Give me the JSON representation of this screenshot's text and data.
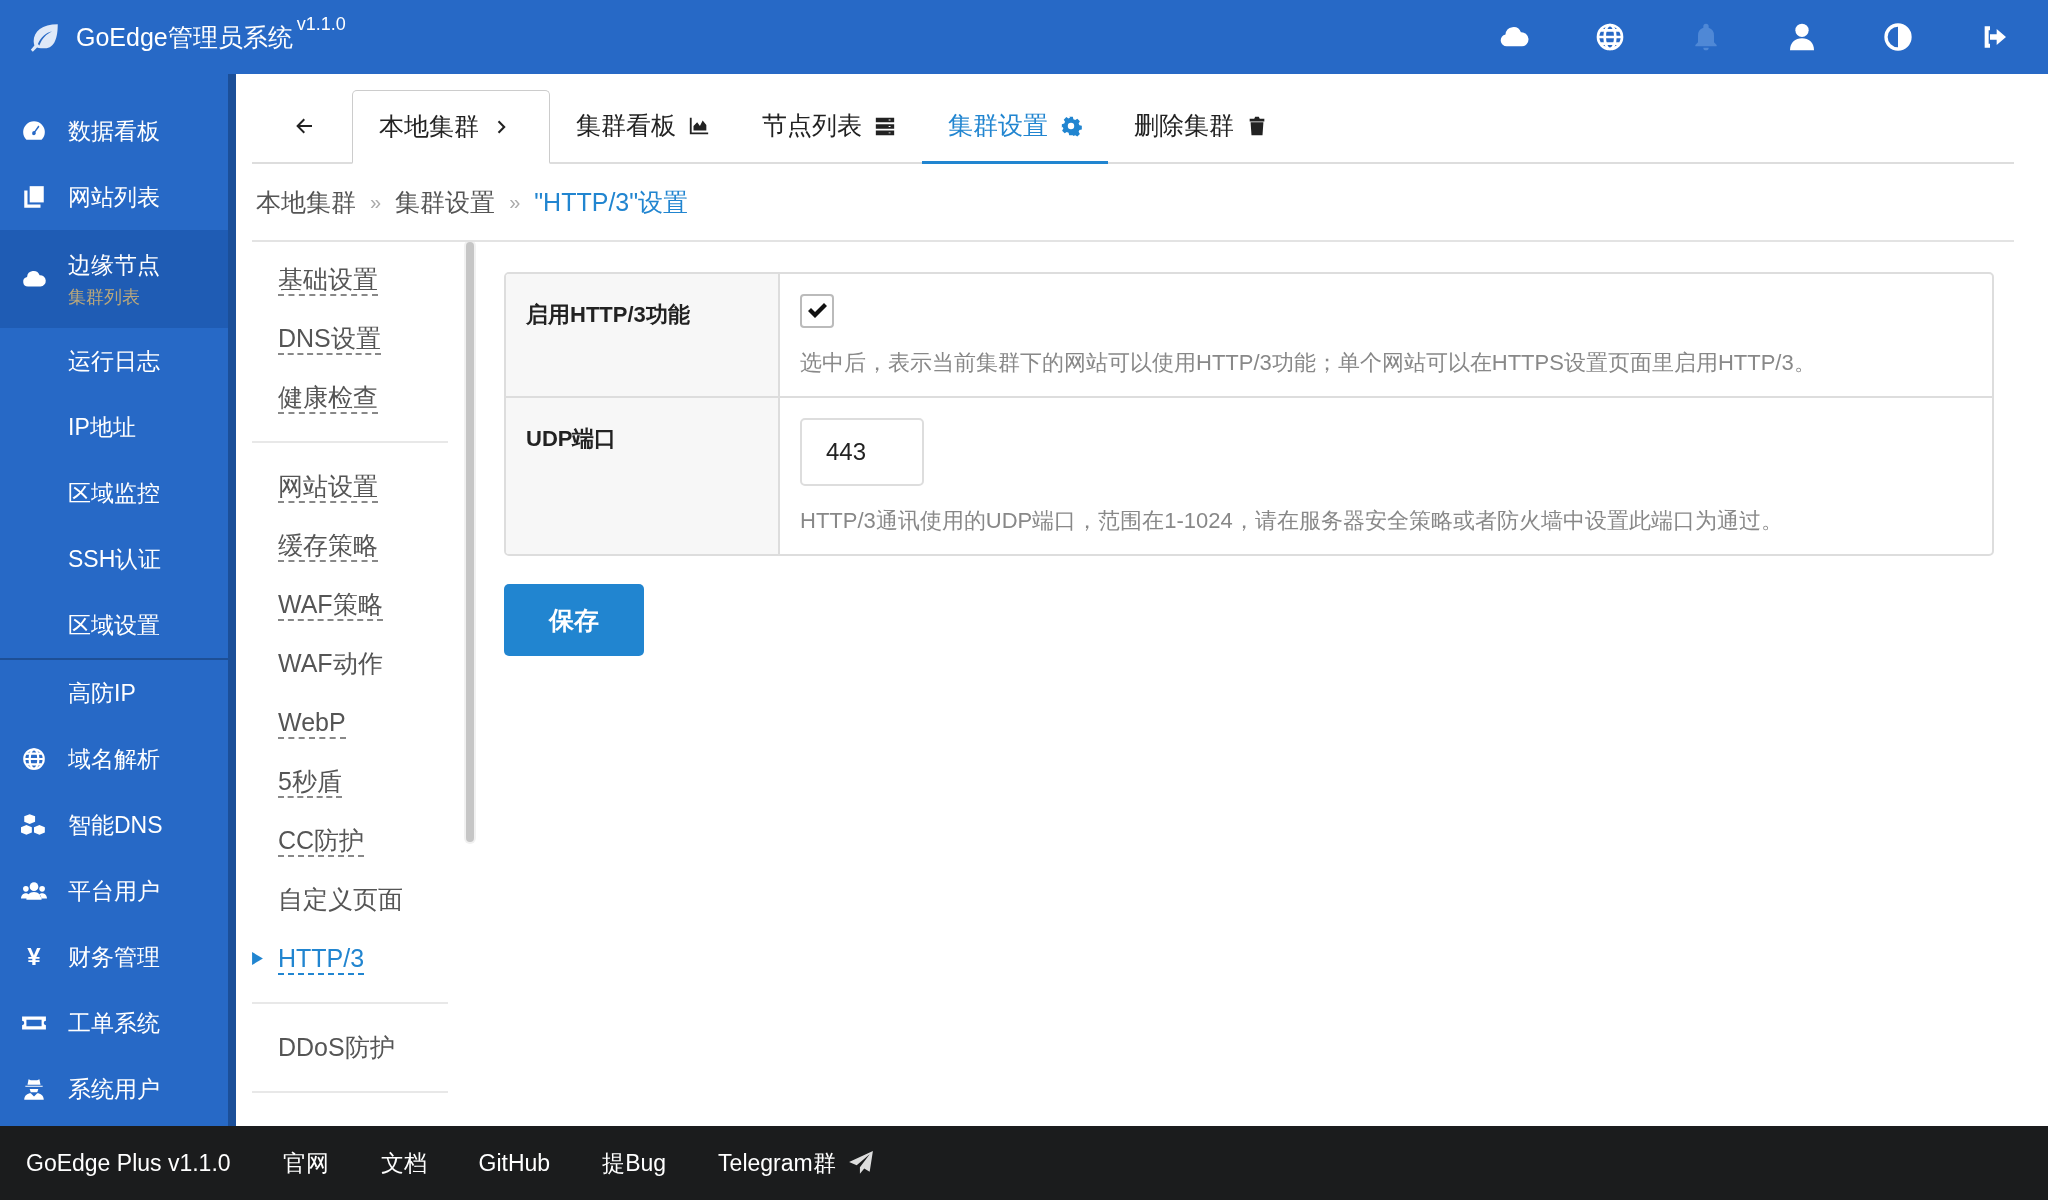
{
  "header": {
    "title": "GoEdge管理员系统",
    "version": "v1.1.0"
  },
  "sidebar": {
    "items": [
      {
        "label": "数据看板",
        "kind": "main",
        "selected": false
      },
      {
        "label": "网站列表",
        "kind": "main",
        "selected": false
      },
      {
        "label": "边缘节点",
        "subtitle": "集群列表",
        "kind": "main",
        "selected": true
      },
      {
        "label": "运行日志",
        "kind": "sub",
        "selected": false
      },
      {
        "label": "IP地址",
        "kind": "sub",
        "selected": false
      },
      {
        "label": "区域监控",
        "kind": "sub",
        "selected": false
      },
      {
        "label": "SSH认证",
        "kind": "sub",
        "selected": false
      },
      {
        "label": "区域设置",
        "kind": "sub",
        "selected": false
      },
      {
        "label": "高防IP",
        "kind": "plain",
        "selected": false
      },
      {
        "label": "域名解析",
        "kind": "main",
        "selected": false
      },
      {
        "label": "智能DNS",
        "kind": "main",
        "selected": false
      },
      {
        "label": "平台用户",
        "kind": "main",
        "selected": false
      },
      {
        "label": "财务管理",
        "kind": "main",
        "glyph": "¥",
        "selected": false
      },
      {
        "label": "工单系统",
        "kind": "main",
        "selected": false
      },
      {
        "label": "系统用户",
        "kind": "main",
        "selected": false
      }
    ]
  },
  "tabs": [
    {
      "label": "本地集群",
      "kind": "cluster",
      "selected": false
    },
    {
      "label": "集群看板",
      "kind": "chart",
      "selected": false
    },
    {
      "label": "节点列表",
      "kind": "server",
      "selected": false
    },
    {
      "label": "集群设置",
      "kind": "gear",
      "selected": true
    },
    {
      "label": "删除集群",
      "kind": "trash",
      "selected": false
    }
  ],
  "breadcrumb": {
    "separator": "»",
    "items": [
      "本地集群",
      "集群设置",
      "\"HTTP/3\"设置"
    ]
  },
  "menu": {
    "groups": [
      [
        {
          "label": "基础设置",
          "configured": true,
          "selected": false
        },
        {
          "label": "DNS设置",
          "configured": true,
          "selected": false
        },
        {
          "label": "健康检查",
          "configured": true,
          "selected": false
        }
      ],
      [
        {
          "label": "网站设置",
          "configured": true,
          "selected": false
        },
        {
          "label": "缓存策略",
          "configured": true,
          "selected": false
        },
        {
          "label": "WAF策略",
          "configured": true,
          "selected": false
        },
        {
          "label": "WAF动作",
          "configured": false,
          "selected": false
        },
        {
          "label": "WebP",
          "configured": true,
          "selected": false
        },
        {
          "label": "5秒盾",
          "configured": true,
          "selected": false
        },
        {
          "label": "CC防护",
          "configured": true,
          "selected": false
        },
        {
          "label": "自定义页面",
          "configured": false,
          "selected": false
        },
        {
          "label": "HTTP/3",
          "configured": true,
          "selected": true
        }
      ],
      [
        {
          "label": "DDoS防护",
          "configured": false,
          "selected": false
        }
      ]
    ]
  },
  "form": {
    "rows": [
      {
        "label": "启用HTTP/3功能",
        "kind": "checkbox",
        "checked": true,
        "help": "选中后，表示当前集群下的网站可以使用HTTP/3功能；单个网站可以在HTTPS设置页面里启用HTTP/3。"
      },
      {
        "label": "UDP端口",
        "kind": "input",
        "value": "443",
        "help": "HTTP/3通讯使用的UDP端口，范围在1-1024，请在服务器安全策略或者防火墙中设置此端口为通过。"
      }
    ],
    "save_button": "保存"
  },
  "footer": {
    "links": [
      "GoEdge Plus v1.1.0",
      "官网",
      "文档",
      "GitHub",
      "提Bug",
      "Telegram群"
    ]
  }
}
